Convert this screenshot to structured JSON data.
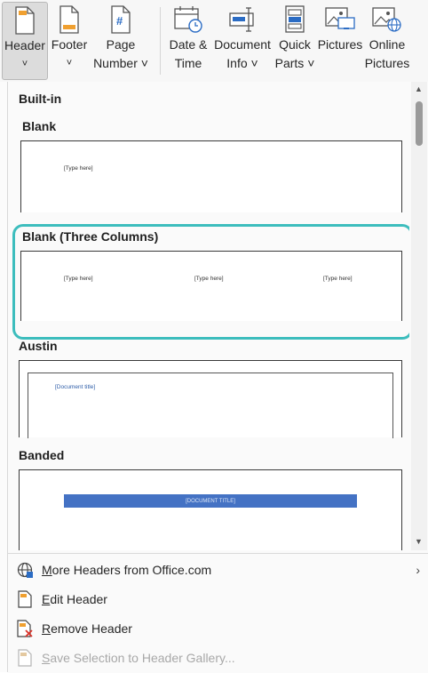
{
  "ribbon": {
    "buttons": [
      {
        "id": "header",
        "line1": "Header",
        "line2": "˅"
      },
      {
        "id": "footer",
        "line1": "Footer",
        "line2": "˅"
      },
      {
        "id": "page_number",
        "line1": "Page",
        "line2": "Number ˅"
      },
      {
        "id": "date_time",
        "line1": "Date &",
        "line2": "Time"
      },
      {
        "id": "document_info",
        "line1": "Document",
        "line2": "Info ˅"
      },
      {
        "id": "quick_parts",
        "line1": "Quick",
        "line2": "Parts ˅"
      },
      {
        "id": "pictures",
        "line1": "Pictures",
        "line2": ""
      },
      {
        "id": "online_pictures",
        "line1": "Online",
        "line2": "Pictures"
      }
    ]
  },
  "gallery": {
    "section_label": "Built-in",
    "templates": [
      {
        "title": "Blank",
        "placeholders": [
          "[Type here]"
        ]
      },
      {
        "title": "Blank (Three Columns)",
        "placeholders": [
          "[Type here]",
          "[Type here]",
          "[Type here]"
        ]
      },
      {
        "title": "Austin",
        "placeholders": [
          "[Document title]"
        ]
      },
      {
        "title": "Banded",
        "placeholders": [
          "[DOCUMENT TITLE]"
        ]
      }
    ],
    "accent_highlight": "#3dbdbd",
    "banded_color": "#4472c4"
  },
  "menu": {
    "more_headers": {
      "access_key": "M",
      "rest": "ore Headers from Office.com"
    },
    "edit_header": {
      "access_key": "E",
      "rest": "dit Header"
    },
    "remove_header": {
      "access_key": "R",
      "rest": "emove Header"
    },
    "save_selection": {
      "access_key": "S",
      "rest": "ave Selection to Header Gallery..."
    }
  }
}
